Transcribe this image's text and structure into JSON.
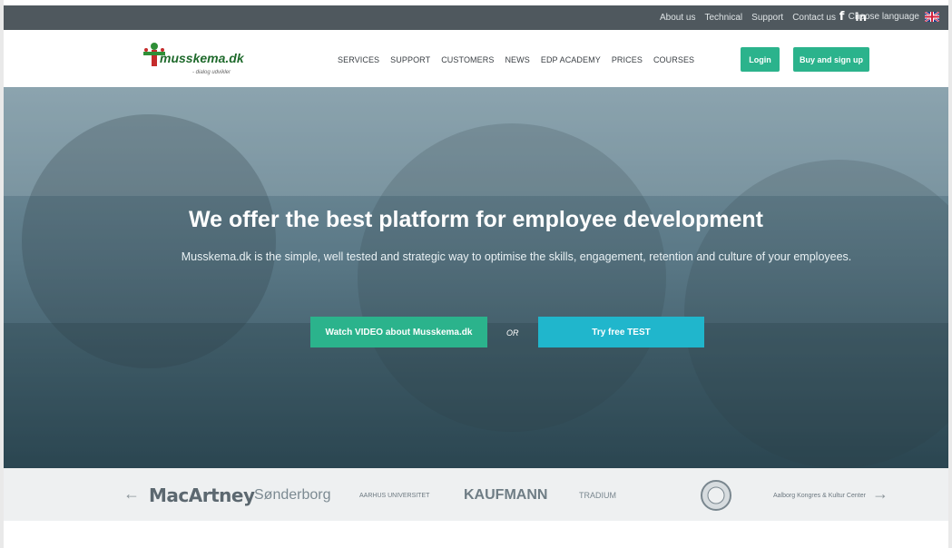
{
  "topbar": {
    "links": [
      "About us",
      "Technical",
      "Support",
      "Contact us"
    ],
    "social": [
      {
        "name": "facebook-icon",
        "glyph": "f"
      },
      {
        "name": "linkedin-icon",
        "glyph": "in"
      }
    ],
    "language_label": "Choose language"
  },
  "header": {
    "logo_text": "musskema.dk",
    "logo_tagline": "- dialog udvikler",
    "nav": [
      "SERVICES",
      "SUPPORT",
      "CUSTOMERS",
      "NEWS",
      "EDP ACADEMY",
      "PRICES",
      "COURSES"
    ],
    "login_label": "Login",
    "signup_label": "Buy and sign up"
  },
  "hero": {
    "headline": "We offer the best platform for employee development",
    "subtext": "Musskema.dk is the simple, well tested and strategic way to optimise the skills, engagement, retention and culture of your employees.",
    "watch_label": "Watch VIDEO about Musskema.dk",
    "or_label": "OR",
    "try_label": "Try free TEST"
  },
  "clients": {
    "prev_glyph": "←",
    "next_glyph": "→",
    "logos": [
      {
        "name": "macartney-logo",
        "text": "MacArtney"
      },
      {
        "name": "sonderborg-logo",
        "text": "Sønderborg"
      },
      {
        "name": "aarhus-logo",
        "text": "AARHUS UNIVERSITET"
      },
      {
        "name": "kaufmann-logo",
        "text": "KAUFMANN"
      },
      {
        "name": "tradium-logo",
        "text": "TRADIUM"
      },
      {
        "name": "seal-logo",
        "text": ""
      },
      {
        "name": "aalborg-logo",
        "text": "Aalborg Kongres & Kultur Center"
      }
    ]
  },
  "colors": {
    "accent": "#2bb38c",
    "accent2": "#20b6cc",
    "topbar_bg": "#4f585e"
  }
}
